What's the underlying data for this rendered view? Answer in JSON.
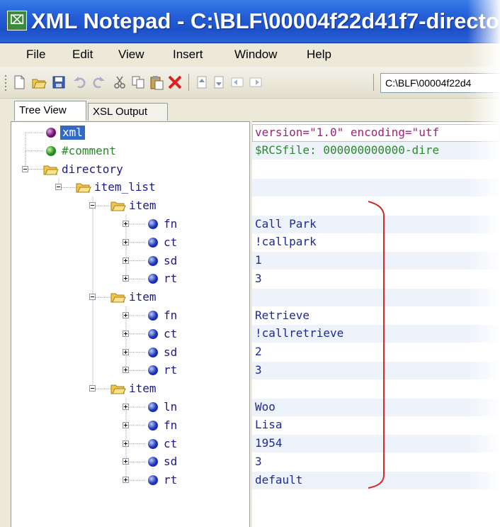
{
  "window": {
    "title": "XML Notepad - C:\\BLF\\00004f22d41f7-directo",
    "icon_glyph": "⌧"
  },
  "menu": [
    "File",
    "Edit",
    "View",
    "Insert",
    "Window",
    "Help"
  ],
  "toolbar": {
    "icons": [
      "new-file-icon",
      "open-folder-icon",
      "save-icon",
      "undo-icon",
      "redo-icon",
      "cut-icon",
      "copy-icon",
      "paste-icon",
      "delete-icon",
      "nudge-up-icon",
      "nudge-down-icon",
      "nudge-left-icon",
      "nudge-right-icon"
    ],
    "path_value": "C:\\BLF\\00004f22d4"
  },
  "tabs": [
    {
      "label": "Tree View",
      "active": true
    },
    {
      "label": "XSL Output",
      "active": false
    }
  ],
  "tree": [
    {
      "label": "xml",
      "kind": "pi",
      "depth": 0,
      "expander": "none",
      "selected": true
    },
    {
      "label": "#comment",
      "kind": "comment",
      "depth": 0,
      "expander": "none"
    },
    {
      "label": "directory",
      "kind": "folder",
      "depth": 0,
      "expander": "minus"
    },
    {
      "label": "item_list",
      "kind": "folder",
      "depth": 1,
      "expander": "minus"
    },
    {
      "label": "item",
      "kind": "folder",
      "depth": 2,
      "expander": "minus"
    },
    {
      "label": "fn",
      "kind": "leaf",
      "depth": 3,
      "expander": "plus"
    },
    {
      "label": "ct",
      "kind": "leaf",
      "depth": 3,
      "expander": "plus"
    },
    {
      "label": "sd",
      "kind": "leaf",
      "depth": 3,
      "expander": "plus"
    },
    {
      "label": "rt",
      "kind": "leaf",
      "depth": 3,
      "expander": "plus"
    },
    {
      "label": "item",
      "kind": "folder",
      "depth": 2,
      "expander": "minus"
    },
    {
      "label": "fn",
      "kind": "leaf",
      "depth": 3,
      "expander": "plus"
    },
    {
      "label": "ct",
      "kind": "leaf",
      "depth": 3,
      "expander": "plus"
    },
    {
      "label": "sd",
      "kind": "leaf",
      "depth": 3,
      "expander": "plus"
    },
    {
      "label": "rt",
      "kind": "leaf",
      "depth": 3,
      "expander": "plus"
    },
    {
      "label": "item",
      "kind": "folder",
      "depth": 2,
      "expander": "minus"
    },
    {
      "label": "ln",
      "kind": "leaf",
      "depth": 3,
      "expander": "plus"
    },
    {
      "label": "fn",
      "kind": "leaf",
      "depth": 3,
      "expander": "plus"
    },
    {
      "label": "ct",
      "kind": "leaf",
      "depth": 3,
      "expander": "plus"
    },
    {
      "label": "sd",
      "kind": "leaf",
      "depth": 3,
      "expander": "plus"
    },
    {
      "label": "rt",
      "kind": "leaf",
      "depth": 3,
      "expander": "plus"
    }
  ],
  "values": [
    {
      "text": "version=\"1.0\" encoding=\"utf",
      "style": "pi"
    },
    {
      "text": "$RCSfile: 000000000000-dire",
      "style": "comment"
    },
    {
      "text": "",
      "style": "normal"
    },
    {
      "text": "",
      "style": "normal"
    },
    {
      "text": "",
      "style": "normal"
    },
    {
      "text": "Call Park",
      "style": "normal"
    },
    {
      "text": "!callpark",
      "style": "normal"
    },
    {
      "text": "1",
      "style": "normal"
    },
    {
      "text": "3",
      "style": "normal"
    },
    {
      "text": "",
      "style": "normal"
    },
    {
      "text": "Retrieve",
      "style": "normal"
    },
    {
      "text": "!callretrieve",
      "style": "normal"
    },
    {
      "text": "2",
      "style": "normal"
    },
    {
      "text": "3",
      "style": "normal"
    },
    {
      "text": "",
      "style": "normal"
    },
    {
      "text": "Woo",
      "style": "normal"
    },
    {
      "text": "Lisa",
      "style": "normal"
    },
    {
      "text": "1954",
      "style": "normal"
    },
    {
      "text": "3",
      "style": "normal"
    },
    {
      "text": "default",
      "style": "normal"
    }
  ],
  "colors": {
    "title_bar": "#2560d8",
    "selection": "#316ac5",
    "pi_text": "#a0207a",
    "comment_text": "#2a8a2a",
    "value_text": "#1a2a9a",
    "annotation_bracket": "#d42a2a",
    "zebra_row": "#eef3fb"
  }
}
